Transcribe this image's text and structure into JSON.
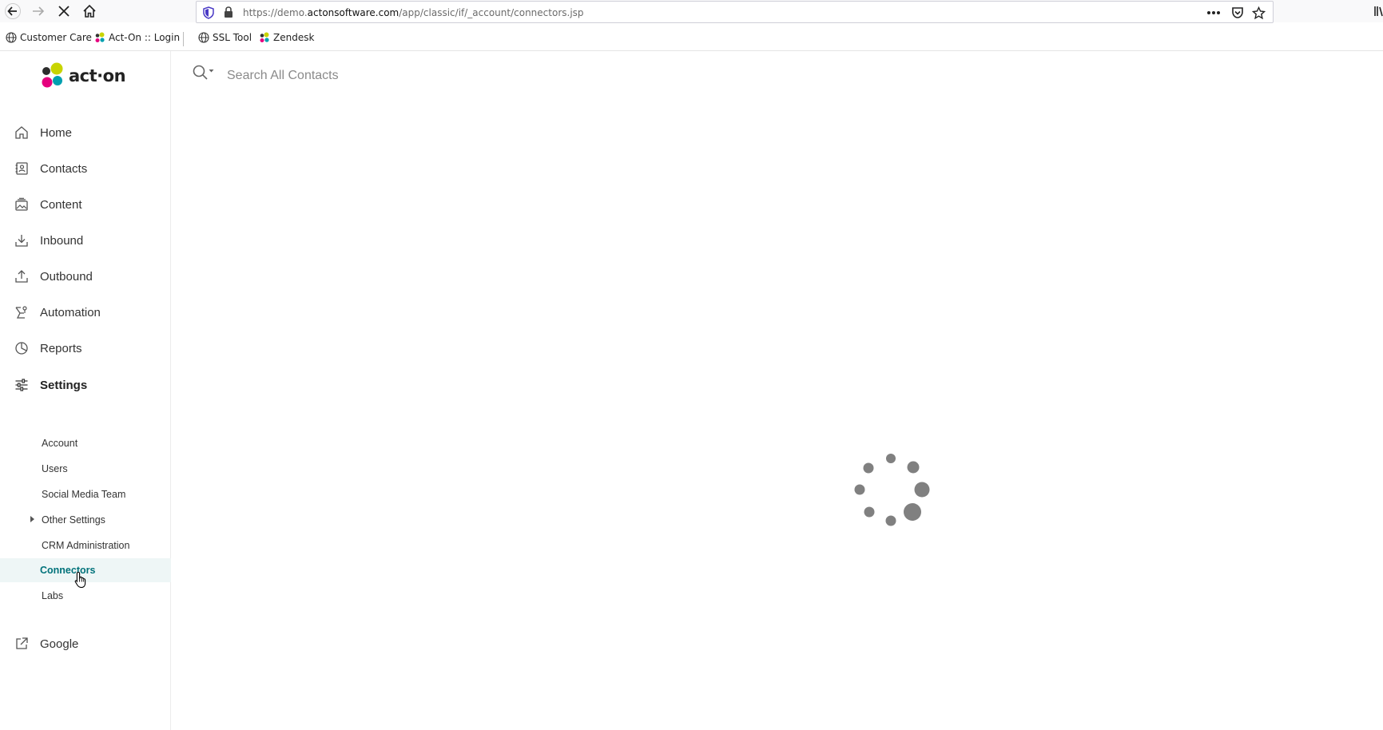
{
  "browser": {
    "url_prefix": "https://demo.",
    "url_host": "actonsoftware.com",
    "url_path": "/app/classic/if/_account/connectors.jsp",
    "bookmarks": [
      {
        "label": "Customer Care",
        "icon": "globe-icon"
      },
      {
        "label": "Act-On :: Login",
        "icon": "acton-icon"
      },
      {
        "label": "SSL Tool",
        "icon": "globe-icon"
      },
      {
        "label": "Zendesk",
        "icon": "acton-icon"
      }
    ]
  },
  "app": {
    "logo_text": "act·on",
    "search_placeholder": "Search All Contacts",
    "accent_color": "#00727a"
  },
  "sidebar": {
    "items": [
      {
        "label": "Home",
        "icon": "home-icon"
      },
      {
        "label": "Contacts",
        "icon": "contacts-icon"
      },
      {
        "label": "Content",
        "icon": "content-icon"
      },
      {
        "label": "Inbound",
        "icon": "inbound-icon"
      },
      {
        "label": "Outbound",
        "icon": "outbound-icon"
      },
      {
        "label": "Automation",
        "icon": "automation-icon"
      },
      {
        "label": "Reports",
        "icon": "reports-icon"
      },
      {
        "label": "Settings",
        "icon": "settings-icon"
      }
    ],
    "settings_sub": [
      {
        "label": "Account"
      },
      {
        "label": "Users"
      },
      {
        "label": "Social Media Team"
      },
      {
        "label": "Other Settings"
      },
      {
        "label": "CRM Administration"
      },
      {
        "label": "Connectors"
      },
      {
        "label": "Labs"
      }
    ],
    "external": {
      "label": "Google",
      "icon": "external-link-icon"
    }
  }
}
